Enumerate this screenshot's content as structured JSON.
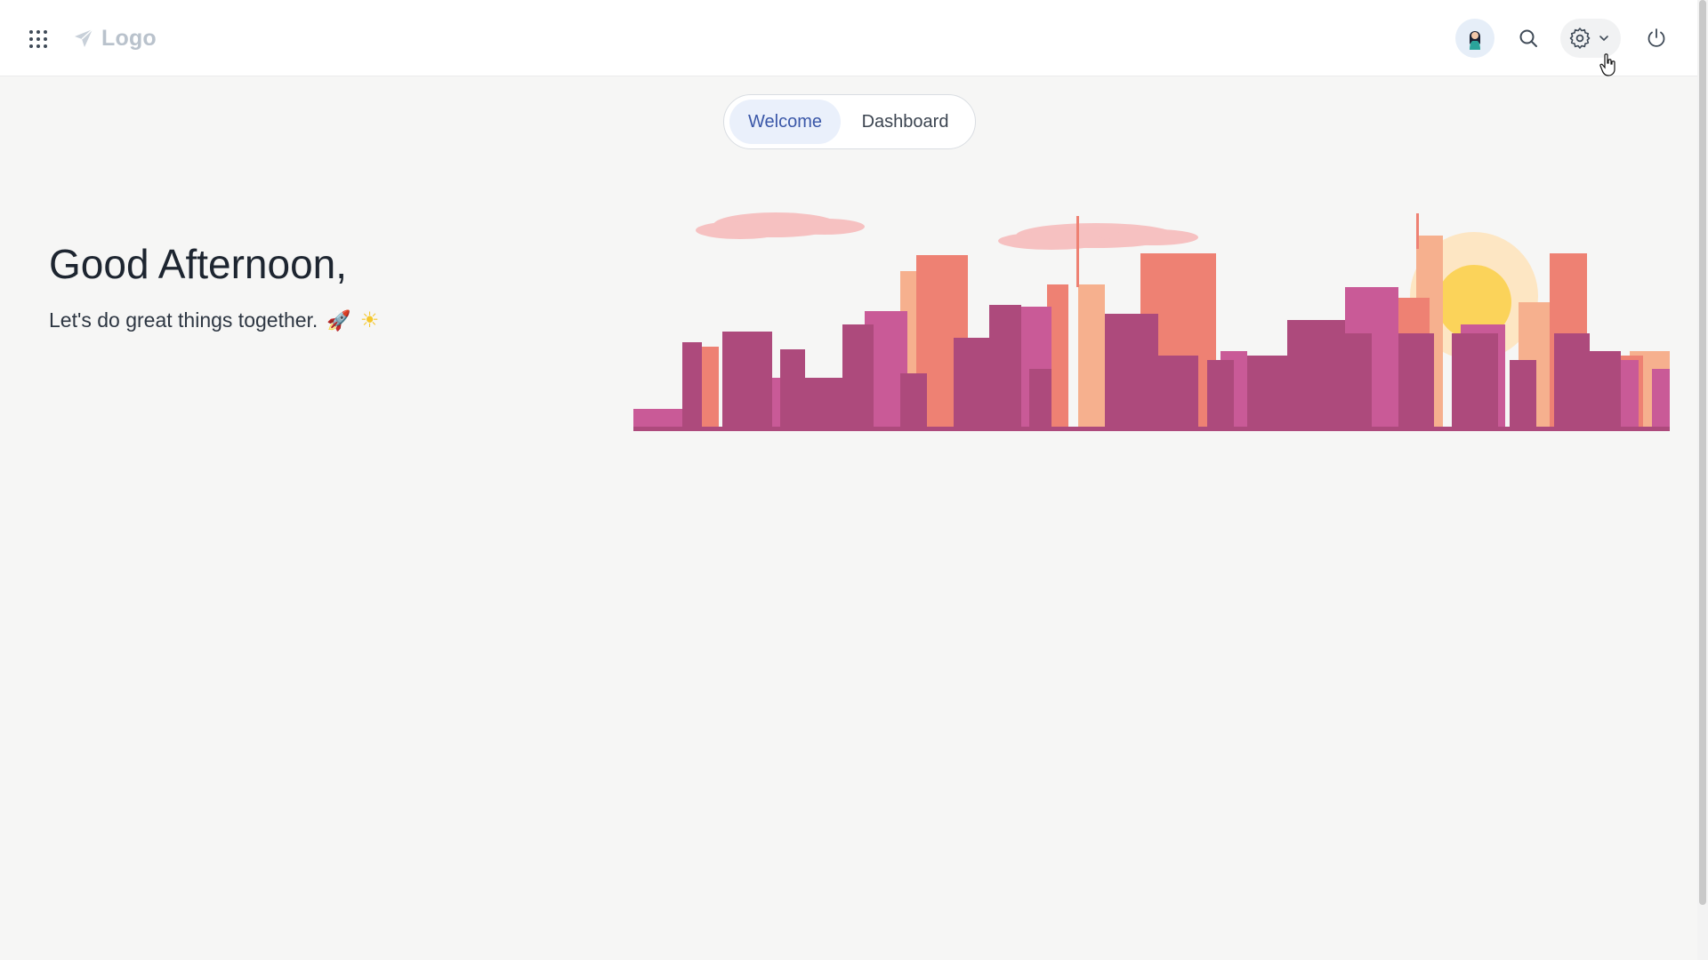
{
  "header": {
    "logo_text": "Logo",
    "apps_icon": "grid-icon",
    "avatar_icon": "user-avatar",
    "search_icon": "search-icon",
    "settings_icon": "gear-icon",
    "power_icon": "power-icon"
  },
  "tabs": [
    {
      "label": "Welcome",
      "active": true
    },
    {
      "label": "Dashboard",
      "active": false
    }
  ],
  "main": {
    "greeting": "Good Afternoon,",
    "subtitle": "Let's do great things together.",
    "emoji_rocket": "🚀",
    "emoji_sun": "☀"
  },
  "colors": {
    "accent": "#3a57a8",
    "skyline_dark": "#ad4a7c",
    "skyline_mid": "#c95a97",
    "skyline_coral": "#ee8173",
    "skyline_peach": "#f6b08e",
    "sun": "#fbd35a",
    "cloud": "#f6b8b8"
  }
}
